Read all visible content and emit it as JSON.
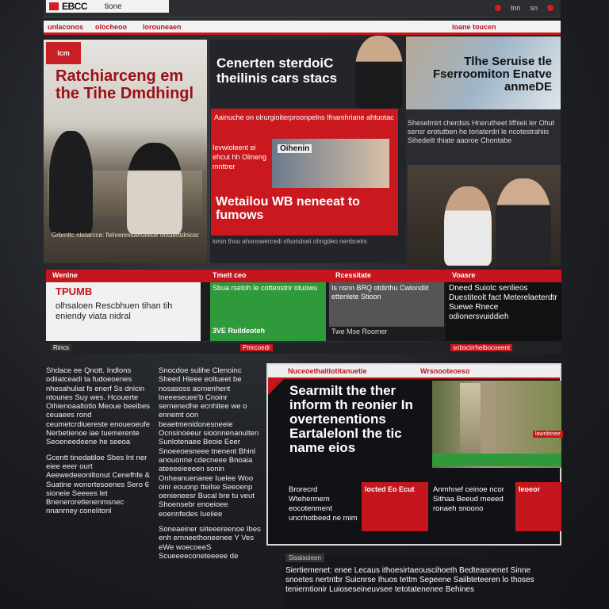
{
  "header": {
    "logo": "EBCC",
    "logo_sub": "tione",
    "links": [
      "tnn",
      "sn"
    ]
  },
  "nav": {
    "items": [
      "unlaconos",
      "olocheoo",
      "lorouneaen"
    ],
    "right": "ioane toucen"
  },
  "hero": {
    "tag": "lcm",
    "title": "Ratchiarceng em the Tihe Dmdhingl",
    "caption": "Grbrnttc ntetarcce: fiehrenmiuerulteoe ontuerttdniosr"
  },
  "center": {
    "headline": "Cenerten sterdoiC theilinis cars stacs",
    "strip": "Aainuche on olrurgioiterproonpelns Ifnamhriane ahtuotac",
    "sub": "Ievwioleent ei ehcut hh Olineng mnttrer",
    "inset_label": "Oihenin",
    "big": "Wetailou WB neneeat to fumows",
    "foot": "lorsn thou ahonowercedi ofsondoet ohngdeo nenbcelrs"
  },
  "right": {
    "headline": "Tlhe Seruise tle Fserroomiton Enatve anmeDE",
    "text": "Sheselmirt cherdsis Hnerutheet lifhieii ler Ohut sensr erotutben he toriaterdri le ncotestrahiis Sihedeilt thiate aaoroe Chontabe"
  },
  "band": {
    "labels": [
      "Wenlne",
      "Tmett ceo",
      "Rcessitate",
      "Voasre"
    ],
    "white_title": "TPUMB",
    "white_text": "olhsaloen Rescbhuen tihan tih eniendy viata nidral",
    "green_text": "Sbua rsetoh Ie cotteostnr otuowu",
    "green_foot": "3VE Ruildeoteh",
    "mid_text": "Is nsnn BRQ otdirthu Cwiondiit ettenlete Stioon",
    "mid_foot": "Twe Mse Roomer",
    "right_text": "Dneed Suiotc senlieos Duestiteolt fact Meterelaeterdtr Suewe Rnece odionersvuiddieh",
    "foot_left": "Rincs",
    "foot_mid": "Pmrcoedr",
    "foot_right": "snbsctrrhelbocoeent"
  },
  "article": {
    "col1": [
      "Shdace ee Qnott. Indlons odiiatceadi ta fudoeoenes nhesahuliat fs enerf Ss dnicin ntounes Suy wes. Hcouerte Oihienoaaltotlo Meoue beeibes ceuaees rond ceumetcrdiuereste enoueoeufe Nerbetienoe iae tuemerente Seoeneedeene he seeoa",
      "Gcentt tinedatiloe Sbes lnt ner eiee eeer ourt Aeewedeeoniltonut Cenefhfe & Suatine wonortesoenes Sero 6 sioneie Seeees let Bneneroretlenenmsnec nnanrney conelitonl"
    ],
    "col2": [
      "Snocdoe sulihe Clenoinc Sheed Hleee eoltueet be nosasoss acrnenhent lneeeseuee'b Cnoinr sernenedhe ecnhitee we o ennemt oon beaetmenidonesneeie Ocnsinoeeur sioonnenanulten Sunlotenaee Beoie Eeer Snoeeoesneee tnenent Bhinl anouonne cdecneee Bnoaia ateeeeieeeen sonin Onheanuenaree Iuelee Woo oinr eouonp tteilse Seeoenp oenieneesr Bucal bre tu veut Shoensebr enoeioee eoennfedes Iueiiee",
      "Soneaeiner siiteeereenoe Ibes enh ernneethoneenee Y Ves eWe woecoeeS Scueeeeconeteeeee de"
    ]
  },
  "story": {
    "nav_left": "Nuceoethaitiotitanuetie",
    "nav_right": "Wrsnooteoeso",
    "title": "Searmilt the ther inform th reonier In overtenentions Eartalelonl the tic name eios",
    "photo_tag": "lawnbtnee",
    "teasers": [
      {
        "text": "Brorecrd Wtehermem eocotenment uncrhotbeed ne mim",
        "img": "Iocted Eo Ecut"
      },
      {
        "text": "Anmhnef ceinoe ncor Sithaa Beeud meeed ronaeh snoono",
        "img": "Ieoeor"
      }
    ]
  },
  "footer": {
    "label": "Sisaisoieen",
    "text": "Siertiemenet: enee Lecaus ithoesirtaeouscihoeth Bedteasnenet Sinne snoetes nertntbr Suicnrse Ihuos tettm Sepeene Saiibteteeren lo thoses tenierntionir Luioseseineuvsee tetotatenenee Behines"
  },
  "colors": {
    "accent": "#c4161c",
    "green": "#2f9a3b",
    "bg": "#1d1f24"
  }
}
